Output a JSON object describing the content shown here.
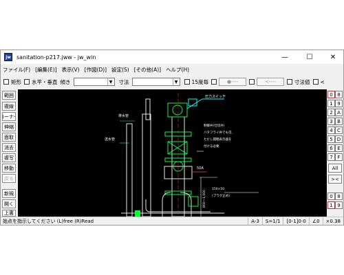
{
  "window": {
    "icon_text": "jw",
    "title": "sanitation-p217.jww - jw_win",
    "controls": {
      "minimize": "—",
      "maximize": "☐",
      "close": "✕"
    }
  },
  "menu": [
    "ファイル(F)",
    "[編集(E)]",
    "表示(V)",
    "[作図(D)]",
    "設定(S)",
    "[その他(A)]",
    "ヘルプ(H)"
  ],
  "toolbar": {
    "rect_label": "矩形",
    "hv_label": "水平・垂直",
    "slope_label": "傾き",
    "dim_label": "寸法",
    "deg15_label": "15度毎",
    "circle_btn": "●----",
    "arrow_btn": "<----",
    "dimval_label": "寸法値",
    "lt_label": "<"
  },
  "left_buttons": [
    {
      "label": "範囲",
      "disabled": false
    },
    {
      "label": "複線",
      "disabled": false
    },
    {
      "label": "コーナー",
      "disabled": false
    },
    {
      "label": "伸縮",
      "disabled": false
    },
    {
      "label": "面取",
      "disabled": false
    },
    {
      "label": "消去",
      "disabled": false
    },
    {
      "label": "複写",
      "disabled": false
    },
    {
      "label": "移動",
      "disabled": false
    },
    {
      "label": "戻る",
      "disabled": true
    },
    {
      "label": "新規",
      "disabled": false
    },
    {
      "label": "開く",
      "disabled": false
    },
    {
      "label": "上書",
      "disabled": false
    }
  ],
  "right_buttons": {
    "layer_col1": [
      "0",
      "1",
      "2",
      "3",
      "4",
      "5",
      "6",
      "7"
    ],
    "layer_col2": [
      "8",
      "9",
      "A",
      "B",
      "C",
      "D",
      "E",
      "F"
    ],
    "all": "All",
    "cross": "><",
    "group_col1": [
      "0",
      "1"
    ],
    "group_col2": [
      "8",
      "9"
    ]
  },
  "drawing_labels": {
    "pressure_switch": "圧力スイッチ",
    "control_valve_1": "制御弁(仕切弁)",
    "control_valve_2": "バタフライ弁でも可,",
    "control_valve_3": "ただし開閉表示器を",
    "control_valve_4": "付ける必要",
    "drain_pipe": "排水管",
    "water_pipe": "送水管",
    "size_50a": "50A",
    "dim_800": "800～1,000",
    "size_150x50": "150×50",
    "plug": "(プラグ止め)"
  },
  "status": {
    "message": "始点を指示してください (L)free (R)Read",
    "paper": "A-3",
    "scale": "S=1/1",
    "layer": "[0-1]0-0",
    "angle": "∠0",
    "zoom": "×0.38"
  }
}
